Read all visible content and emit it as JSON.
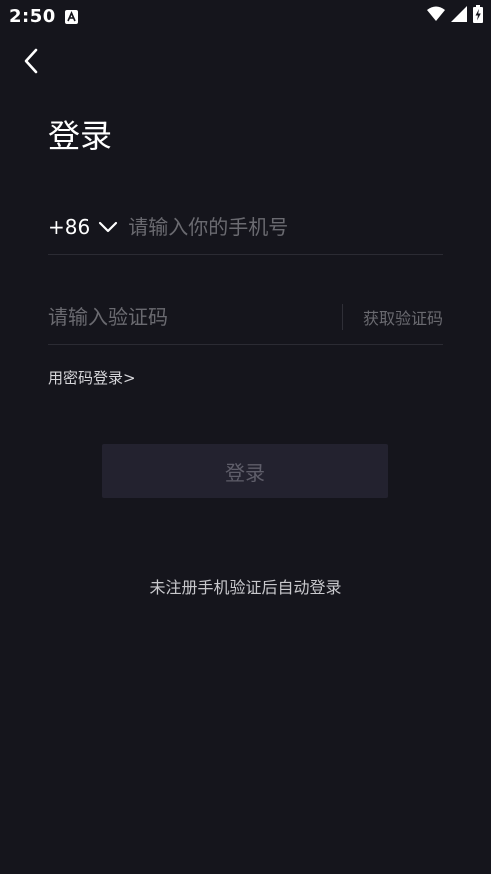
{
  "status_bar": {
    "time": "2:50",
    "notification_icon": "text-a-icon",
    "icons": [
      "wifi-icon",
      "cellular-signal-icon",
      "battery-charging-icon"
    ]
  },
  "header": {
    "back_icon": "chevron-left-icon",
    "title": "登录"
  },
  "phone": {
    "country_code": "+86",
    "country_code_icon": "chevron-down-icon",
    "placeholder": "请输入你的手机号",
    "value": ""
  },
  "verification": {
    "placeholder": "请输入验证码",
    "value": "",
    "get_code_label": "获取验证码"
  },
  "password_login_label": "用密码登录>",
  "login_button_label": "登录",
  "note": "未注册手机验证后自动登录",
  "colors": {
    "background": "#15151c",
    "login_button_bg": "#23222f",
    "login_button_text": "#5f5e6a",
    "placeholder": "#6a6a70",
    "divider": "#2b2b33"
  }
}
